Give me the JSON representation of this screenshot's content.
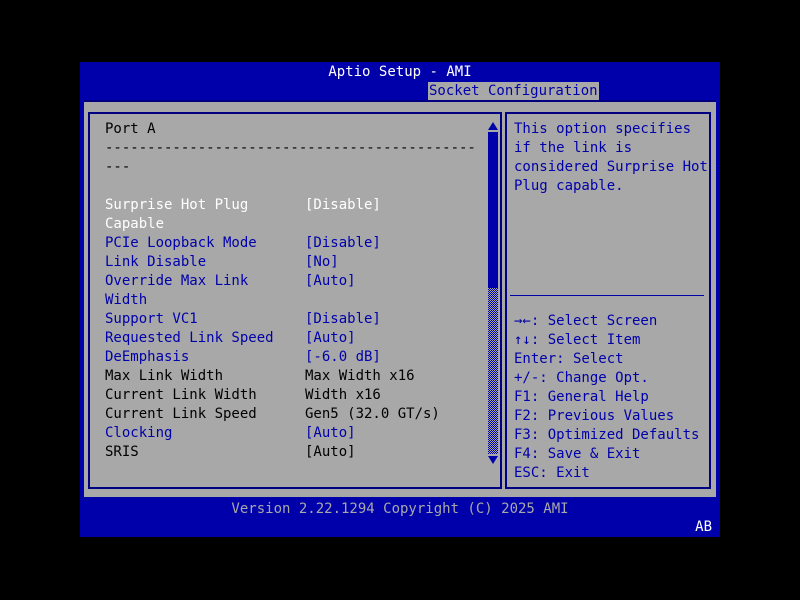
{
  "titlebar": {
    "title": "Aptio Setup - AMI"
  },
  "tabs": {
    "active": "Socket Configuration"
  },
  "left_panel": {
    "section_title": "Port A",
    "divider_line_1": "--------------------------------------------",
    "divider_line_2": "---",
    "items": [
      {
        "label": "Surprise Hot Plug Capable",
        "value": "[Disable]",
        "state": "selected"
      },
      {
        "label": "PCIe Loopback Mode",
        "value": "[Disable]",
        "state": "normal"
      },
      {
        "label": "Link Disable",
        "value": "[No]",
        "state": "normal"
      },
      {
        "label": "Override Max Link Width",
        "value": "[Auto]",
        "state": "normal"
      },
      {
        "label": "Support VC1",
        "value": "[Disable]",
        "state": "normal"
      },
      {
        "label": "Requested Link Speed",
        "value": "[Auto]",
        "state": "normal"
      },
      {
        "label": "DeEmphasis",
        "value": "[-6.0 dB]",
        "state": "normal"
      },
      {
        "label": "Max Link Width",
        "value": "Max Width x16",
        "state": "grayed"
      },
      {
        "label": "Current Link Width",
        "value": "Width x16",
        "state": "grayed"
      },
      {
        "label": "Current Link Speed",
        "value": "Gen5 (32.0 GT/s)",
        "state": "grayed"
      },
      {
        "label": "Clocking",
        "value": "[Auto]",
        "state": "normal"
      },
      {
        "label": "SRIS",
        "value": "[Auto]",
        "state": "grayed"
      }
    ]
  },
  "right_panel": {
    "help_text": "This option specifies if the link is considered Surprise Hot Plug capable.",
    "keys": [
      {
        "label": "→←: Select Screen"
      },
      {
        "label": "↑↓: Select Item"
      },
      {
        "label": "Enter: Select"
      },
      {
        "label": "+/-: Change Opt."
      },
      {
        "label": "F1: General Help"
      },
      {
        "label": "F2: Previous Values"
      },
      {
        "label": "F3: Optimized Defaults"
      },
      {
        "label": "F4: Save & Exit"
      },
      {
        "label": "ESC: Exit"
      }
    ]
  },
  "footer": {
    "version_text": "Version 2.22.1294 Copyright (C) 2025 AMI",
    "badge": "AB"
  },
  "colors": {
    "band_blue": "#0000AA",
    "panel_gray": "#A8A8A8",
    "border_navy": "#000080",
    "item_blue": "#0000AA",
    "selected_white": "#FFFFFF",
    "grayed_black": "#000000"
  }
}
